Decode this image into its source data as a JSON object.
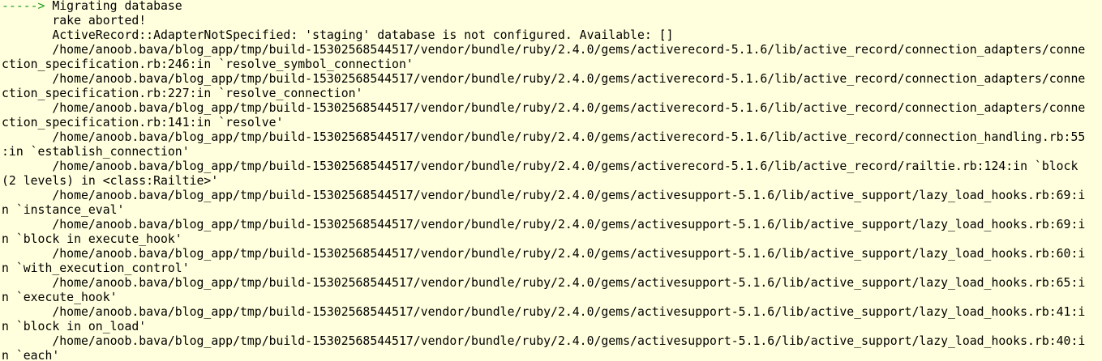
{
  "terminal": {
    "arrow": "----->",
    "header": " Migrating database",
    "colors": {
      "background": "#ffffdd",
      "text": "#000000",
      "arrow": "#1f9c1f"
    },
    "lines": [
      "       rake aborted!",
      "       ActiveRecord::AdapterNotSpecified: 'staging' database is not configured. Available: []",
      "       /home/anoob.bava/blog_app/tmp/build-15302568544517/vendor/bundle/ruby/2.4.0/gems/activerecord-5.1.6/lib/active_record/connection_adapters/conne",
      "ction_specification.rb:246:in `resolve_symbol_connection'",
      "       /home/anoob.bava/blog_app/tmp/build-15302568544517/vendor/bundle/ruby/2.4.0/gems/activerecord-5.1.6/lib/active_record/connection_adapters/conne",
      "ction_specification.rb:227:in `resolve_connection'",
      "       /home/anoob.bava/blog_app/tmp/build-15302568544517/vendor/bundle/ruby/2.4.0/gems/activerecord-5.1.6/lib/active_record/connection_adapters/conne",
      "ction_specification.rb:141:in `resolve'",
      "       /home/anoob.bava/blog_app/tmp/build-15302568544517/vendor/bundle/ruby/2.4.0/gems/activerecord-5.1.6/lib/active_record/connection_handling.rb:55",
      ":in `establish_connection'",
      "       /home/anoob.bava/blog_app/tmp/build-15302568544517/vendor/bundle/ruby/2.4.0/gems/activerecord-5.1.6/lib/active_record/railtie.rb:124:in `block",
      "(2 levels) in <class:Railtie>'",
      "       /home/anoob.bava/blog_app/tmp/build-15302568544517/vendor/bundle/ruby/2.4.0/gems/activesupport-5.1.6/lib/active_support/lazy_load_hooks.rb:69:i",
      "n `instance_eval'",
      "       /home/anoob.bava/blog_app/tmp/build-15302568544517/vendor/bundle/ruby/2.4.0/gems/activesupport-5.1.6/lib/active_support/lazy_load_hooks.rb:69:i",
      "n `block in execute_hook'",
      "       /home/anoob.bava/blog_app/tmp/build-15302568544517/vendor/bundle/ruby/2.4.0/gems/activesupport-5.1.6/lib/active_support/lazy_load_hooks.rb:60:i",
      "n `with_execution_control'",
      "       /home/anoob.bava/blog_app/tmp/build-15302568544517/vendor/bundle/ruby/2.4.0/gems/activesupport-5.1.6/lib/active_support/lazy_load_hooks.rb:65:i",
      "n `execute_hook'",
      "       /home/anoob.bava/blog_app/tmp/build-15302568544517/vendor/bundle/ruby/2.4.0/gems/activesupport-5.1.6/lib/active_support/lazy_load_hooks.rb:41:i",
      "n `block in on_load'",
      "       /home/anoob.bava/blog_app/tmp/build-15302568544517/vendor/bundle/ruby/2.4.0/gems/activesupport-5.1.6/lib/active_support/lazy_load_hooks.rb:40:i",
      "n `each'"
    ]
  }
}
